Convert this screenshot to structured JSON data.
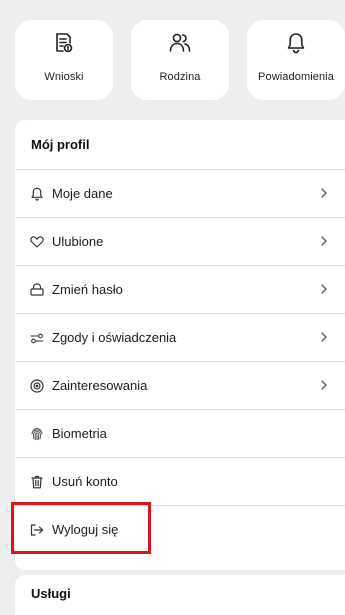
{
  "tiles": [
    {
      "label": "Wnioski",
      "icon": "document-icon"
    },
    {
      "label": "Rodzina",
      "icon": "people-icon"
    },
    {
      "label": "Powiadomienia",
      "icon": "bell-icon"
    }
  ],
  "profile": {
    "title": "Mój profil",
    "items": [
      {
        "label": "Moje dane",
        "icon": "bell-icon",
        "chevron": true
      },
      {
        "label": "Ulubione",
        "icon": "heart-icon",
        "chevron": true
      },
      {
        "label": "Zmień hasło",
        "icon": "lock-icon",
        "chevron": true
      },
      {
        "label": "Zgody i oświadczenia",
        "icon": "toggles-icon",
        "chevron": true
      },
      {
        "label": "Zainteresowania",
        "icon": "target-icon",
        "chevron": true
      },
      {
        "label": "Biometria",
        "icon": "fingerprint-icon",
        "chevron": false
      },
      {
        "label": "Usuń konto",
        "icon": "trash-icon",
        "chevron": false
      },
      {
        "label": "Wyloguj się",
        "icon": "logout-icon",
        "chevron": false
      }
    ]
  },
  "services": {
    "title": "Usługi"
  },
  "colors": {
    "background": "#eeeeee",
    "card": "#ffffff",
    "highlight": "#d9161f"
  }
}
